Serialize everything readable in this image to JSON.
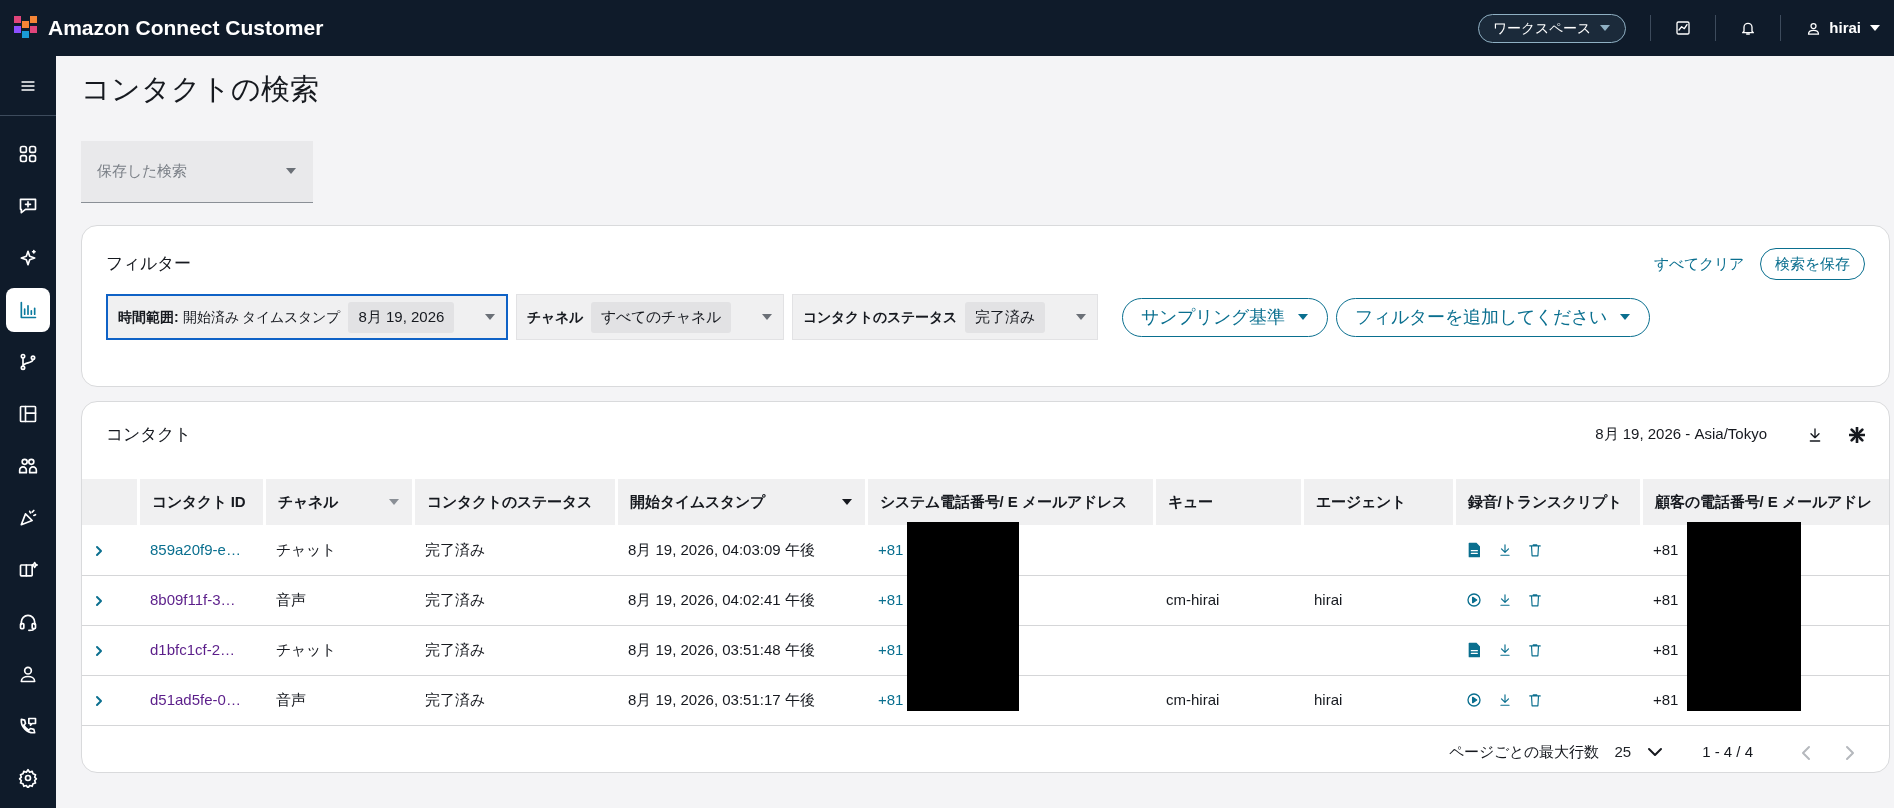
{
  "header": {
    "product": "Amazon Connect Customer",
    "workspace_button": "ワークスペース",
    "user": "hirai"
  },
  "sidebar": {
    "items": [
      {
        "selected": false
      },
      {
        "selected": false
      },
      {
        "selected": false
      },
      {
        "selected": true
      },
      {
        "selected": false
      },
      {
        "selected": false
      },
      {
        "selected": false
      },
      {
        "selected": false
      },
      {
        "selected": false
      },
      {
        "selected": false
      },
      {
        "selected": false
      },
      {
        "selected": false
      },
      {
        "selected": false
      }
    ]
  },
  "page_title": "コンタクトの検索",
  "saved_search": {
    "placeholder": "保存した検索"
  },
  "filters": {
    "title": "フィルター",
    "clear_link": "すべてクリア",
    "save_button": "検索を保存",
    "chips": [
      {
        "label": "時間範囲:",
        "text": "開始済み タイムスタンプ",
        "value": "8月 19, 2026",
        "focused": true
      },
      {
        "label": "チャネル",
        "value": "すべてのチャネル",
        "focused": false
      },
      {
        "label": "コンタクトのステータス",
        "value": "完了済み",
        "focused": false
      }
    ],
    "menus": [
      "サンプリング基準",
      "フィルターを追加してください"
    ]
  },
  "contacts": {
    "title": "コンタクト",
    "date_range": "8月 19, 2026 - Asia/Tokyo",
    "table": {
      "columns": [
        {
          "label": "コンタクト ID",
          "kind": "plain"
        },
        {
          "label": "チャネル",
          "kind": "filter"
        },
        {
          "label": "コンタクトのステータス",
          "kind": "plain"
        },
        {
          "label": "開始タイムスタンプ",
          "kind": "sort"
        },
        {
          "label": "システム電話番号/ E メールアドレス",
          "kind": "plain"
        },
        {
          "label": "キュー",
          "kind": "plain"
        },
        {
          "label": "エージェント",
          "kind": "plain"
        },
        {
          "label": "録音/トランスクリプト",
          "kind": "plain"
        },
        {
          "label": "顧客の電話番号/ E メールアドレ",
          "kind": "plain"
        }
      ],
      "rows": [
        {
          "id": "859a20f9-e…",
          "visited": false,
          "channel": "チャット",
          "status": "完了済み",
          "start": "8月 19, 2026, 04:03:09 午後",
          "system_phone": "+81",
          "kind": "transcript",
          "customer_phone": "+81"
        },
        {
          "id": "8b09f11f-3…",
          "visited": true,
          "channel": "音声",
          "status": "完了済み",
          "start": "8月 19, 2026, 04:02:41 午後",
          "system_phone": "+81",
          "queue": "cm-hirai",
          "agent": "hirai",
          "kind": "recording",
          "customer_phone": "+81"
        },
        {
          "id": "d1bfc1cf-2…",
          "visited": true,
          "channel": "チャット",
          "status": "完了済み",
          "start": "8月 19, 2026, 03:51:48 午後",
          "system_phone": "+81",
          "kind": "transcript",
          "customer_phone": "+81"
        },
        {
          "id": "d51ad5fe-0…",
          "visited": true,
          "channel": "音声",
          "status": "完了済み",
          "start": "8月 19, 2026, 03:51:17 午後",
          "system_phone": "+81",
          "queue": "cm-hirai",
          "agent": "hirai",
          "kind": "recording",
          "customer_phone": "+81"
        }
      ]
    },
    "pagination": {
      "rows_label": "ページごとの最大行数",
      "rows_value": "25",
      "range": "1 - 4 / 4",
      "prev_disabled": true,
      "next_disabled": true
    }
  }
}
